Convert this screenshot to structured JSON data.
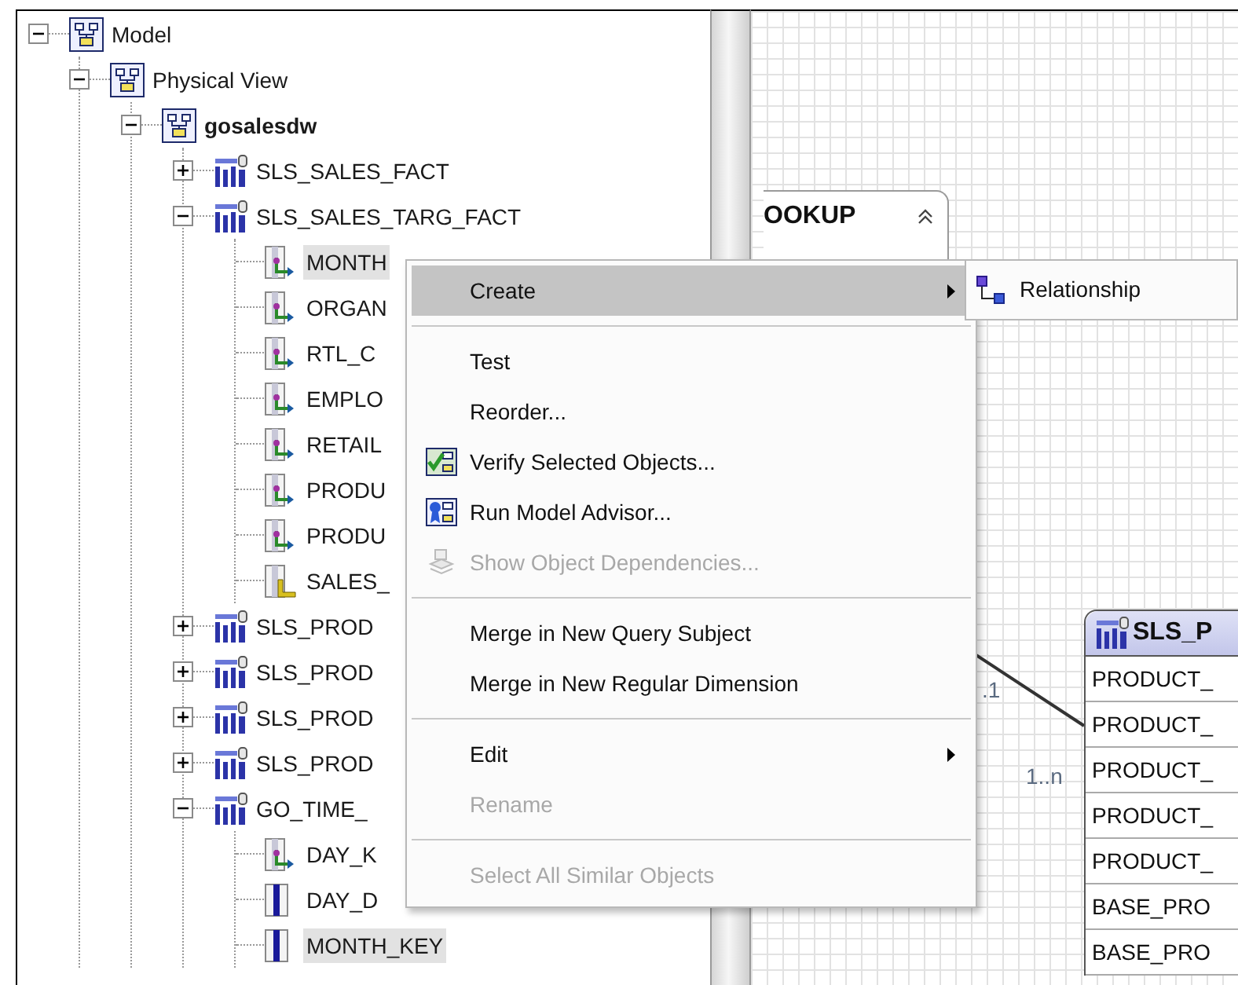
{
  "tree": [
    {
      "label": "Model",
      "kind": "model",
      "expanded": true,
      "selected": false,
      "children": [
        {
          "label": "Physical View",
          "kind": "model",
          "expanded": true,
          "selected": false,
          "children": [
            {
              "label": "gosalesdw",
              "kind": "datasource",
              "expanded": true,
              "selected": false,
              "children": [
                {
                  "label": "SLS_SALES_FACT",
                  "kind": "table",
                  "expanded": false,
                  "selected": false
                },
                {
                  "label": "SLS_SALES_TARG_FACT",
                  "kind": "table",
                  "expanded": true,
                  "selected": false,
                  "children": [
                    {
                      "label": "MONTH",
                      "kind": "key",
                      "selected": true
                    },
                    {
                      "label": "ORGAN",
                      "kind": "key",
                      "selected": false
                    },
                    {
                      "label": "RTL_C",
                      "kind": "key",
                      "selected": false
                    },
                    {
                      "label": "EMPLO",
                      "kind": "key",
                      "selected": false
                    },
                    {
                      "label": "RETAIL",
                      "kind": "key",
                      "selected": false
                    },
                    {
                      "label": "PRODU",
                      "kind": "key",
                      "selected": false
                    },
                    {
                      "label": "PRODU",
                      "kind": "key",
                      "selected": false
                    },
                    {
                      "label": "SALES_",
                      "kind": "measure",
                      "selected": false
                    }
                  ]
                },
                {
                  "label": "SLS_PROD",
                  "kind": "table",
                  "expanded": false,
                  "selected": false
                },
                {
                  "label": "SLS_PROD",
                  "kind": "table",
                  "expanded": false,
                  "selected": false
                },
                {
                  "label": "SLS_PROD",
                  "kind": "table",
                  "expanded": false,
                  "selected": false
                },
                {
                  "label": "SLS_PROD",
                  "kind": "table",
                  "expanded": false,
                  "selected": false
                },
                {
                  "label": "GO_TIME_",
                  "kind": "table",
                  "expanded": true,
                  "selected": false,
                  "children": [
                    {
                      "label": "DAY_K",
                      "kind": "key",
                      "selected": false
                    },
                    {
                      "label": "DAY_D",
                      "kind": "column",
                      "selected": false
                    },
                    {
                      "label": "MONTH_KEY",
                      "kind": "column",
                      "selected": true
                    }
                  ]
                }
              ]
            }
          ]
        }
      ]
    }
  ],
  "canvas": {
    "lookup_box": {
      "title": "OOKUP"
    },
    "connector": {
      "labels": [
        ".1",
        "1..n"
      ]
    },
    "table": {
      "title": "SLS_P",
      "rows": [
        "PRODUCT_",
        "PRODUCT_",
        "PRODUCT_",
        "PRODUCT_",
        "PRODUCT_",
        "BASE_PRO",
        "BASE_PRO"
      ]
    }
  },
  "context_menu": {
    "items": [
      {
        "kind": "plain",
        "label": "Create",
        "selected": true,
        "disabled": false,
        "submenu": true
      },
      {
        "kind": "separator"
      },
      {
        "kind": "plain",
        "label": "Test",
        "selected": false,
        "disabled": false,
        "submenu": false
      },
      {
        "kind": "plain",
        "label": "Reorder...",
        "selected": false,
        "disabled": false,
        "submenu": false
      },
      {
        "kind": "verify",
        "label": "Verify Selected Objects...",
        "selected": false,
        "disabled": false,
        "submenu": false
      },
      {
        "kind": "advisor",
        "label": "Run Model Advisor...",
        "selected": false,
        "disabled": false,
        "submenu": false
      },
      {
        "kind": "dependencies",
        "label": "Show Object Dependencies...",
        "selected": false,
        "disabled": true,
        "submenu": false
      },
      {
        "kind": "separator"
      },
      {
        "kind": "plain",
        "label": "Merge in New Query Subject",
        "selected": false,
        "disabled": false,
        "submenu": false
      },
      {
        "kind": "plain",
        "label": "Merge in New Regular Dimension",
        "selected": false,
        "disabled": false,
        "submenu": false
      },
      {
        "kind": "separator"
      },
      {
        "kind": "plain",
        "label": "Edit",
        "selected": false,
        "disabled": false,
        "submenu": true
      },
      {
        "kind": "plain",
        "label": "Rename",
        "selected": false,
        "disabled": true,
        "submenu": false
      },
      {
        "kind": "separator"
      },
      {
        "kind": "plain",
        "label": "Select All Similar Objects",
        "selected": false,
        "disabled": true,
        "submenu": false
      }
    ]
  },
  "submenu": {
    "items": [
      {
        "label": "Relationship"
      }
    ]
  }
}
